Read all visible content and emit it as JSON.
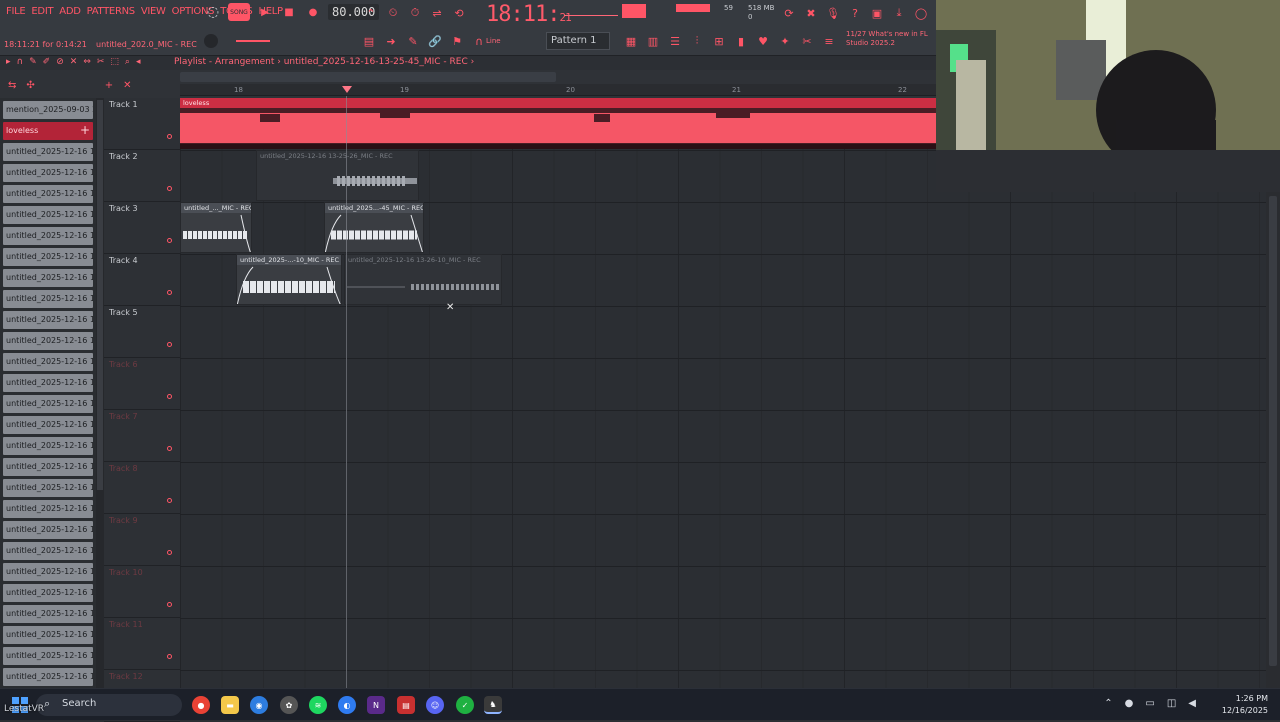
{
  "menu": [
    "FILE",
    "EDIT",
    "ADD",
    "PATTERNS",
    "VIEW",
    "OPTIONS",
    "TOOLS",
    "HELP"
  ],
  "transport": {
    "song_badge": "SONG",
    "tempo": "80.000",
    "clock_main": "18:11",
    "clock_sub": "21",
    "time_display": "18:11:21 for 0:14:21",
    "current_file": "untitled_202.0_MIC - REC",
    "pattern": "Pattern 1",
    "snap": "Line",
    "memory": "518 MB",
    "cpu": "59",
    "voices": "0",
    "news_count": "11/27",
    "news_text": "What's new in FL Studio 2025.2"
  },
  "playlist": {
    "title": "Playlist - Arrangement",
    "clip_path": "untitled_2025-12-16-13-25-45_MIC - REC",
    "ruler": [
      "18",
      "19",
      "20",
      "21",
      "22"
    ]
  },
  "browser": {
    "items": [
      "mention_2025-09-03 22...",
      "loveless",
      "untitled_2025-12-16 13-...",
      "untitled_2025-12-16 13-...",
      "untitled_2025-12-16 13-...",
      "untitled_2025-12-16 13-...",
      "untitled_2025-12-16 13-...",
      "untitled_2025-12-16 13-...",
      "untitled_2025-12-16 13-...",
      "untitled_2025-12-16 13-...",
      "untitled_2025-12-16 13-...",
      "untitled_2025-12-16 13-...",
      "untitled_2025-12-16 13-...",
      "untitled_2025-12-16 13-...",
      "untitled_2025-12-16 13-...",
      "untitled_2025-12-16 13-...",
      "untitled_2025-12-16 13-...",
      "untitled_2025-12-16 13-...",
      "untitled_2025-12-16 13-...",
      "untitled_2025-12-16 13-...",
      "untitled_2025-12-16 13-...",
      "untitled_2025-12-16 13-...",
      "untitled_2025-12-16 13-...",
      "untitled_2025-12-16 13-...",
      "untitled_2025-12-16 13-...",
      "untitled_2025-12-16 13-...",
      "untitled_2025-12-16 13-...",
      "untitled_2025-12-16 13-..."
    ],
    "selected_index": 1
  },
  "tracks": [
    "Track 1",
    "Track 2",
    "Track 3",
    "Track 4",
    "Track 5",
    "Track 6",
    "Track 7",
    "Track 8",
    "Track 9",
    "Track 10",
    "Track 11",
    "Track 12"
  ],
  "clips": {
    "loveless": "loveless",
    "t2": "untitled_2025-12-16 13-25-26_MIC - REC",
    "t3a": "untitled_..._MIC - REC",
    "t3b": "untitled_2025...-45_MIC - REC",
    "t4a": "untitled_2025-...-10_MIC - REC",
    "t4b": "untitled_2025-12-16 13-26-10_MIC - REC"
  },
  "taskbar": {
    "search": "Search",
    "user_overlay": "LestatVR",
    "time": "1:26 PM",
    "date": "12/16/2025"
  },
  "colors": {
    "accent": "#ff5566",
    "selected_clip": "#b32438",
    "audio_red": "#ff5a6a"
  }
}
